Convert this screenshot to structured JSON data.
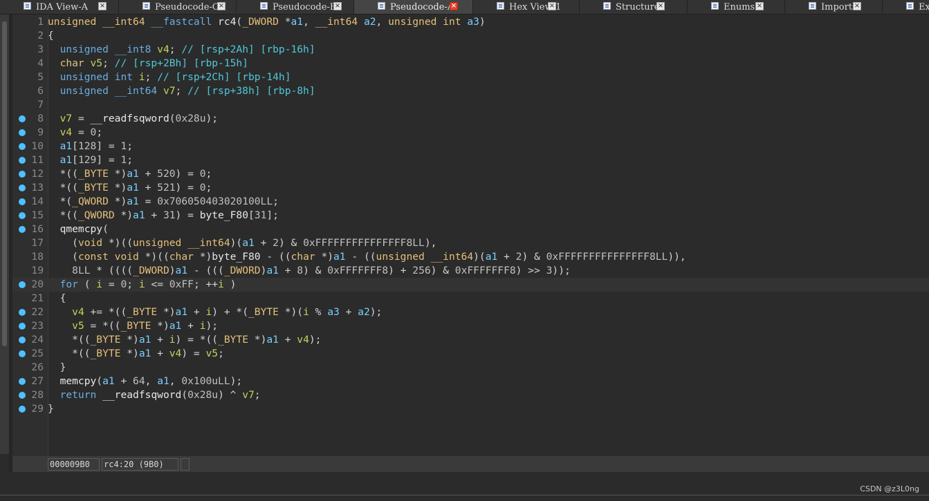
{
  "tabs": [
    {
      "label": "IDA View-A",
      "active": false
    },
    {
      "label": "Pseudocode-C",
      "active": false
    },
    {
      "label": "Pseudocode-B",
      "active": false
    },
    {
      "label": "Pseudocode-A",
      "active": true
    },
    {
      "label": "Hex View-1",
      "active": false
    },
    {
      "label": "Structures",
      "active": false
    },
    {
      "label": "Enums",
      "active": false
    },
    {
      "label": "Imports",
      "active": false
    },
    {
      "label": "Expo",
      "active": false
    }
  ],
  "code": {
    "highlighted_line": 20,
    "lines": [
      {
        "n": "1",
        "bp": false,
        "t": [
          [
            "tp",
            "unsigned __int64 "
          ],
          [
            "kw",
            "__fastcall "
          ],
          [
            "fn",
            "rc4"
          ],
          [
            "pl",
            "("
          ],
          [
            "tp",
            "_DWORD "
          ],
          [
            "pl",
            "*"
          ],
          [
            "arg",
            "a1"
          ],
          [
            "pl",
            ", "
          ],
          [
            "tp",
            "__int64 "
          ],
          [
            "arg",
            "a2"
          ],
          [
            "pl",
            ", "
          ],
          [
            "tp",
            "unsigned int "
          ],
          [
            "arg",
            "a3"
          ],
          [
            "pl",
            ")"
          ]
        ]
      },
      {
        "n": "2",
        "bp": false,
        "t": [
          [
            "pl",
            "{"
          ]
        ]
      },
      {
        "n": "3",
        "bp": false,
        "t": [
          [
            "pl",
            "  "
          ],
          [
            "kw",
            "unsigned __int8 "
          ],
          [
            "var",
            "v4"
          ],
          [
            "pl",
            "; "
          ],
          [
            "cm",
            "// [rsp+2Ah] [rbp-16h]"
          ]
        ]
      },
      {
        "n": "4",
        "bp": false,
        "t": [
          [
            "pl",
            "  "
          ],
          [
            "tp",
            "char "
          ],
          [
            "var",
            "v5"
          ],
          [
            "pl",
            "; "
          ],
          [
            "cm",
            "// [rsp+2Bh] [rbp-15h]"
          ]
        ]
      },
      {
        "n": "5",
        "bp": false,
        "t": [
          [
            "pl",
            "  "
          ],
          [
            "kw",
            "unsigned int "
          ],
          [
            "var",
            "i"
          ],
          [
            "pl",
            "; "
          ],
          [
            "cm",
            "// [rsp+2Ch] [rbp-14h]"
          ]
        ]
      },
      {
        "n": "6",
        "bp": false,
        "t": [
          [
            "pl",
            "  "
          ],
          [
            "kw",
            "unsigned __int64 "
          ],
          [
            "var",
            "v7"
          ],
          [
            "pl",
            "; "
          ],
          [
            "cm",
            "// [rsp+38h] [rbp-8h]"
          ]
        ]
      },
      {
        "n": "7",
        "bp": false,
        "t": [
          [
            "pl",
            ""
          ]
        ]
      },
      {
        "n": "8",
        "bp": true,
        "t": [
          [
            "pl",
            "  "
          ],
          [
            "var",
            "v7"
          ],
          [
            "pl",
            " = "
          ],
          [
            "fn",
            "__readfsqword"
          ],
          [
            "pl",
            "("
          ],
          [
            "num",
            "0x28u"
          ],
          [
            "pl",
            ");"
          ]
        ]
      },
      {
        "n": "9",
        "bp": true,
        "t": [
          [
            "pl",
            "  "
          ],
          [
            "var",
            "v4"
          ],
          [
            "pl",
            " = "
          ],
          [
            "num",
            "0"
          ],
          [
            "pl",
            ";"
          ]
        ]
      },
      {
        "n": "10",
        "bp": true,
        "t": [
          [
            "pl",
            "  "
          ],
          [
            "arg",
            "a1"
          ],
          [
            "pl",
            "["
          ],
          [
            "num",
            "128"
          ],
          [
            "pl",
            "] = "
          ],
          [
            "num",
            "1"
          ],
          [
            "pl",
            ";"
          ]
        ]
      },
      {
        "n": "11",
        "bp": true,
        "t": [
          [
            "pl",
            "  "
          ],
          [
            "arg",
            "a1"
          ],
          [
            "pl",
            "["
          ],
          [
            "num",
            "129"
          ],
          [
            "pl",
            "] = "
          ],
          [
            "num",
            "1"
          ],
          [
            "pl",
            ";"
          ]
        ]
      },
      {
        "n": "12",
        "bp": true,
        "t": [
          [
            "pl",
            "  *(("
          ],
          [
            "tp",
            "_BYTE "
          ],
          [
            "pl",
            "*)"
          ],
          [
            "arg",
            "a1"
          ],
          [
            "pl",
            " + "
          ],
          [
            "num",
            "520"
          ],
          [
            "pl",
            ") = "
          ],
          [
            "num",
            "0"
          ],
          [
            "pl",
            ";"
          ]
        ]
      },
      {
        "n": "13",
        "bp": true,
        "t": [
          [
            "pl",
            "  *(("
          ],
          [
            "tp",
            "_BYTE "
          ],
          [
            "pl",
            "*)"
          ],
          [
            "arg",
            "a1"
          ],
          [
            "pl",
            " + "
          ],
          [
            "num",
            "521"
          ],
          [
            "pl",
            ") = "
          ],
          [
            "num",
            "0"
          ],
          [
            "pl",
            ";"
          ]
        ]
      },
      {
        "n": "14",
        "bp": true,
        "t": [
          [
            "pl",
            "  *("
          ],
          [
            "tp",
            "_QWORD "
          ],
          [
            "pl",
            "*)"
          ],
          [
            "arg",
            "a1"
          ],
          [
            "pl",
            " = "
          ],
          [
            "num",
            "0x706050403020100LL"
          ],
          [
            "pl",
            ";"
          ]
        ]
      },
      {
        "n": "15",
        "bp": true,
        "t": [
          [
            "pl",
            "  *(("
          ],
          [
            "tp",
            "_QWORD "
          ],
          [
            "pl",
            "*)"
          ],
          [
            "arg",
            "a1"
          ],
          [
            "pl",
            " + "
          ],
          [
            "num",
            "31"
          ],
          [
            "pl",
            ") = "
          ],
          [
            "gv",
            "byte_F80"
          ],
          [
            "pl",
            "["
          ],
          [
            "num",
            "31"
          ],
          [
            "pl",
            "];"
          ]
        ]
      },
      {
        "n": "16",
        "bp": true,
        "t": [
          [
            "pl",
            "  "
          ],
          [
            "fn",
            "qmemcpy"
          ],
          [
            "pl",
            "("
          ]
        ]
      },
      {
        "n": "17",
        "bp": false,
        "t": [
          [
            "pl",
            "    ("
          ],
          [
            "tp",
            "void "
          ],
          [
            "pl",
            "*)(("
          ],
          [
            "tp",
            "unsigned __int64"
          ],
          [
            "pl",
            ")("
          ],
          [
            "arg",
            "a1"
          ],
          [
            "pl",
            " + "
          ],
          [
            "num",
            "2"
          ],
          [
            "pl",
            ") & "
          ],
          [
            "num",
            "0xFFFFFFFFFFFFFFF8LL"
          ],
          [
            "pl",
            "),"
          ]
        ]
      },
      {
        "n": "18",
        "bp": false,
        "t": [
          [
            "pl",
            "    ("
          ],
          [
            "tp",
            "const void "
          ],
          [
            "pl",
            "*)(("
          ],
          [
            "tp",
            "char "
          ],
          [
            "pl",
            "*)"
          ],
          [
            "gv",
            "byte_F80"
          ],
          [
            "pl",
            " - (("
          ],
          [
            "tp",
            "char "
          ],
          [
            "pl",
            "*)"
          ],
          [
            "arg",
            "a1"
          ],
          [
            "pl",
            " - (("
          ],
          [
            "tp",
            "unsigned __int64"
          ],
          [
            "pl",
            ")("
          ],
          [
            "arg",
            "a1"
          ],
          [
            "pl",
            " + "
          ],
          [
            "num",
            "2"
          ],
          [
            "pl",
            ") & "
          ],
          [
            "num",
            "0xFFFFFFFFFFFFFFF8LL"
          ],
          [
            "pl",
            ")),"
          ]
        ]
      },
      {
        "n": "19",
        "bp": false,
        "t": [
          [
            "pl",
            "    "
          ],
          [
            "num",
            "8LL"
          ],
          [
            "pl",
            " * (((("
          ],
          [
            "tp",
            "_DWORD"
          ],
          [
            "pl",
            ")"
          ],
          [
            "arg",
            "a1"
          ],
          [
            "pl",
            " - ((("
          ],
          [
            "tp",
            "_DWORD"
          ],
          [
            "pl",
            ")"
          ],
          [
            "arg",
            "a1"
          ],
          [
            "pl",
            " + "
          ],
          [
            "num",
            "8"
          ],
          [
            "pl",
            ") & "
          ],
          [
            "num",
            "0xFFFFFFF8"
          ],
          [
            "pl",
            ") + "
          ],
          [
            "num",
            "256"
          ],
          [
            "pl",
            ") & "
          ],
          [
            "num",
            "0xFFFFFFF8"
          ],
          [
            "pl",
            ") >> "
          ],
          [
            "num",
            "3"
          ],
          [
            "pl",
            "));"
          ]
        ]
      },
      {
        "n": "20",
        "bp": true,
        "t": [
          [
            "pl",
            "  "
          ],
          [
            "kw",
            "for"
          ],
          [
            "pl",
            " ( "
          ],
          [
            "var",
            "i"
          ],
          [
            "pl",
            " = "
          ],
          [
            "num",
            "0"
          ],
          [
            "pl",
            "; "
          ],
          [
            "var",
            "i"
          ],
          [
            "pl",
            " <= "
          ],
          [
            "num",
            "0xFF"
          ],
          [
            "pl",
            "; ++"
          ],
          [
            "var",
            "i"
          ],
          [
            "pl",
            " )"
          ]
        ]
      },
      {
        "n": "21",
        "bp": false,
        "t": [
          [
            "pl",
            "  {"
          ]
        ]
      },
      {
        "n": "22",
        "bp": true,
        "t": [
          [
            "pl",
            "    "
          ],
          [
            "var",
            "v4"
          ],
          [
            "pl",
            " += *(("
          ],
          [
            "tp",
            "_BYTE "
          ],
          [
            "pl",
            "*)"
          ],
          [
            "arg",
            "a1"
          ],
          [
            "pl",
            " + "
          ],
          [
            "var",
            "i"
          ],
          [
            "pl",
            ") + *("
          ],
          [
            "tp",
            "_BYTE "
          ],
          [
            "pl",
            "*)("
          ],
          [
            "var",
            "i"
          ],
          [
            "pl",
            " % "
          ],
          [
            "arg",
            "a3"
          ],
          [
            "pl",
            " + "
          ],
          [
            "arg",
            "a2"
          ],
          [
            "pl",
            ");"
          ]
        ]
      },
      {
        "n": "23",
        "bp": true,
        "t": [
          [
            "pl",
            "    "
          ],
          [
            "var",
            "v5"
          ],
          [
            "pl",
            " = *(("
          ],
          [
            "tp",
            "_BYTE "
          ],
          [
            "pl",
            "*)"
          ],
          [
            "arg",
            "a1"
          ],
          [
            "pl",
            " + "
          ],
          [
            "var",
            "i"
          ],
          [
            "pl",
            ");"
          ]
        ]
      },
      {
        "n": "24",
        "bp": true,
        "t": [
          [
            "pl",
            "    *(("
          ],
          [
            "tp",
            "_BYTE "
          ],
          [
            "pl",
            "*)"
          ],
          [
            "arg",
            "a1"
          ],
          [
            "pl",
            " + "
          ],
          [
            "var",
            "i"
          ],
          [
            "pl",
            ") = *(("
          ],
          [
            "tp",
            "_BYTE "
          ],
          [
            "pl",
            "*)"
          ],
          [
            "arg",
            "a1"
          ],
          [
            "pl",
            " + "
          ],
          [
            "var",
            "v4"
          ],
          [
            "pl",
            ");"
          ]
        ]
      },
      {
        "n": "25",
        "bp": true,
        "t": [
          [
            "pl",
            "    *(("
          ],
          [
            "tp",
            "_BYTE "
          ],
          [
            "pl",
            "*)"
          ],
          [
            "arg",
            "a1"
          ],
          [
            "pl",
            " + "
          ],
          [
            "var",
            "v4"
          ],
          [
            "pl",
            ") = "
          ],
          [
            "var",
            "v5"
          ],
          [
            "pl",
            ";"
          ]
        ]
      },
      {
        "n": "26",
        "bp": false,
        "t": [
          [
            "pl",
            "  }"
          ]
        ]
      },
      {
        "n": "27",
        "bp": true,
        "t": [
          [
            "pl",
            "  "
          ],
          [
            "fn",
            "memcpy"
          ],
          [
            "pl",
            "("
          ],
          [
            "arg",
            "a1"
          ],
          [
            "pl",
            " + "
          ],
          [
            "num",
            "64"
          ],
          [
            "pl",
            ", "
          ],
          [
            "arg",
            "a1"
          ],
          [
            "pl",
            ", "
          ],
          [
            "num",
            "0x100uLL"
          ],
          [
            "pl",
            ");"
          ]
        ]
      },
      {
        "n": "28",
        "bp": true,
        "t": [
          [
            "pl",
            "  "
          ],
          [
            "kw",
            "return "
          ],
          [
            "fn",
            "__readfsqword"
          ],
          [
            "pl",
            "("
          ],
          [
            "num",
            "0x28u"
          ],
          [
            "pl",
            ") ^ "
          ],
          [
            "var",
            "v7"
          ],
          [
            "pl",
            ";"
          ]
        ]
      },
      {
        "n": "29",
        "bp": true,
        "t": [
          [
            "pl",
            "}"
          ]
        ]
      }
    ]
  },
  "status": {
    "address": "000009B0",
    "location": "rc4:20 (9B0)"
  },
  "watermark": "CSDN @z3L0ng",
  "colors": {
    "breakpoint": "#4fc1ff",
    "active_tab_close": "#e0432b"
  }
}
